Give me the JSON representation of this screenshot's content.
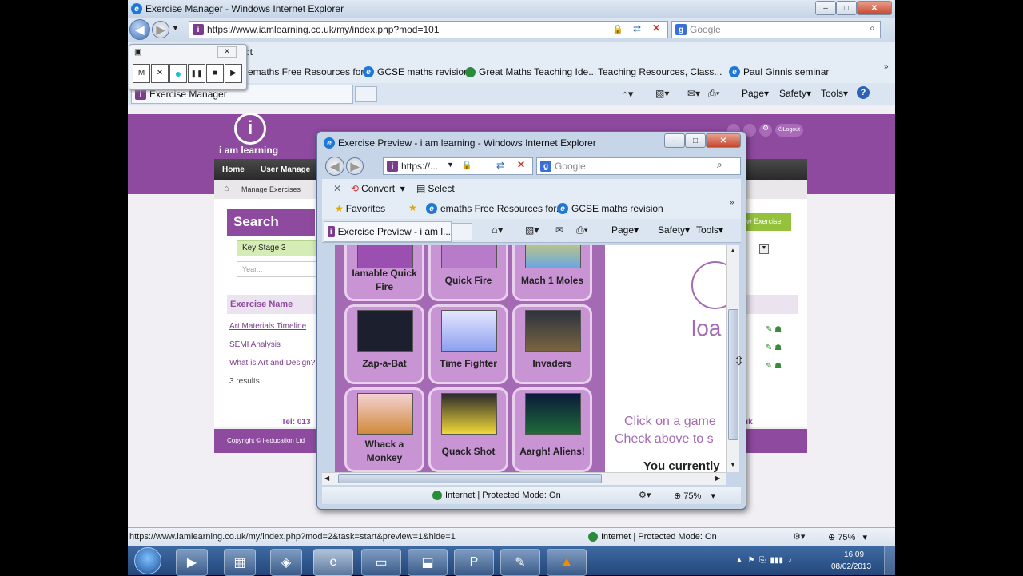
{
  "main_window": {
    "title": "Exercise Manager - Windows Internet Explorer",
    "url": "https://www.iamlearning.co.uk/my/index.php?mod=101",
    "search_placeholder": "Google",
    "favorites": [
      "emaths Free Resources for...",
      "GCSE maths revision",
      "Great Maths Teaching Ide...",
      "Teaching Resources, Class...",
      "Paul Ginnis seminar"
    ],
    "tab_label": "Exercise Manager",
    "menus": [
      "Page",
      "Safety",
      "Tools"
    ],
    "status_url": "https://www.iamlearning.co.uk/my/index.php?mod=2&task=start&preview=1&hide=1",
    "status_zone": "Internet | Protected Mode: On",
    "zoom": "75%",
    "select_label": "ect"
  },
  "recorder": {
    "buttons": [
      "M",
      "✕",
      "●",
      "❚❚",
      "■",
      "▶"
    ]
  },
  "site": {
    "logo_text": "i am learning",
    "nav": [
      "Home",
      "User Manage"
    ],
    "breadcrumb": "Manage Exercises",
    "search_heading": "Search",
    "key_stage": "Key Stage 3",
    "year_placeholder": "Year...",
    "new_exercise": "w Exercise",
    "logout": "Logout",
    "column_header": "Exercise Name",
    "rows": [
      "Art Materials Timeline",
      "SEMI Analysis",
      "What is Art and Design?"
    ],
    "results": "3 results",
    "tel": "Tel: 013",
    "uk": "uk",
    "copyright": "Copyright © i-education Ltd"
  },
  "popup": {
    "title": "Exercise Preview - i am learning - Windows Internet Explorer",
    "url": "https://...",
    "search_placeholder": "Google",
    "convert": "Convert",
    "select": "Select",
    "favorites_label": "Favorites",
    "favorites": [
      "emaths Free Resources for...",
      "GCSE maths revision"
    ],
    "tab_label": "Exercise Preview - i am l...",
    "menus": [
      "Page",
      "Safety",
      "Tools"
    ],
    "status_zone": "Internet | Protected Mode: On",
    "zoom": "75%",
    "games": [
      {
        "label": "Iamable Quick Fire"
      },
      {
        "label": "Quick Fire"
      },
      {
        "label": "Mach 1 Moles"
      },
      {
        "label": "Zap-a-Bat"
      },
      {
        "label": "Time Fighter"
      },
      {
        "label": "Invaders"
      },
      {
        "label": "Whack a Monkey"
      },
      {
        "label": "Quack Shot"
      },
      {
        "label": "Aargh! Aliens!"
      }
    ],
    "loading_text": "loa",
    "click_line1": "Click on a game",
    "click_line2": "Check above to s",
    "currently": "You currently"
  },
  "taskbar": {
    "time": "16:09",
    "date": "08/02/2013"
  },
  "colors": {
    "purple": "#8d4a9e",
    "tile": "#c894d4"
  }
}
